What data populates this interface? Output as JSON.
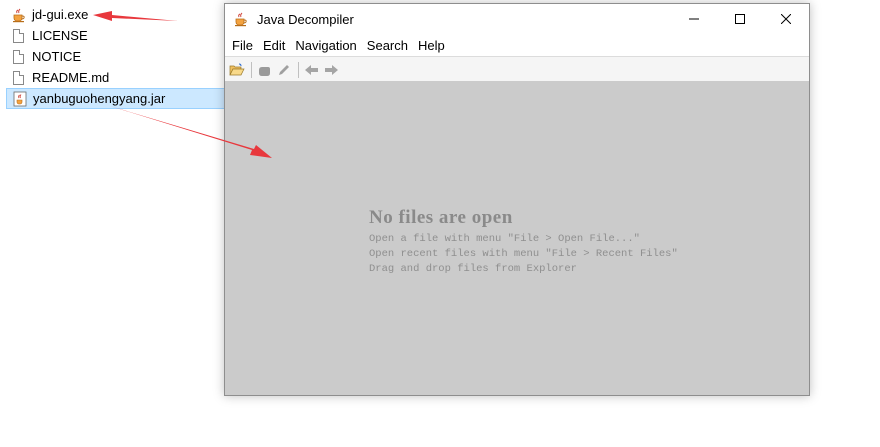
{
  "explorer": {
    "files": [
      {
        "name": "jd-gui.exe",
        "icon": "java-cup-icon"
      },
      {
        "name": "LICENSE",
        "icon": "document-icon"
      },
      {
        "name": "NOTICE",
        "icon": "document-icon"
      },
      {
        "name": "README.md",
        "icon": "document-icon"
      },
      {
        "name": "yanbuguohengyang.jar",
        "icon": "jar-icon"
      }
    ]
  },
  "window": {
    "title": "Java Decompiler",
    "menu": [
      "File",
      "Edit",
      "Navigation",
      "Search",
      "Help"
    ],
    "empty": {
      "title": "No files are open",
      "lines": [
        "Open a file with menu \"File > Open File...\"",
        "Open recent files with menu \"File > Recent Files\"",
        "Drag and drop files from Explorer"
      ]
    }
  },
  "colors": {
    "arrow": "#e8383d",
    "content_bg": "#cbcbcb",
    "selection_bg": "#cce8ff"
  }
}
